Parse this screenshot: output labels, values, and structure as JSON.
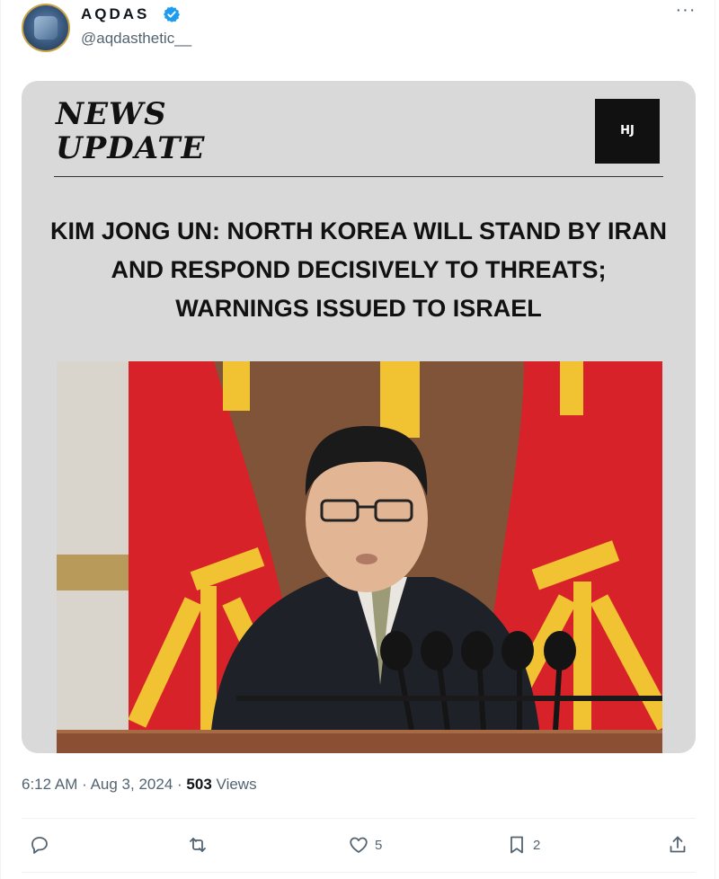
{
  "author": {
    "display_name": "AQDAS",
    "handle": "@aqdasthetic__",
    "verified": true
  },
  "more_label": "···",
  "card": {
    "logo_line1": "NEWS",
    "logo_line2": "UPDATE",
    "badge": "HJ",
    "headline": "KIM JONG UN: NORTH KOREA WILL STAND BY IRAN AND RESPOND DECISIVELY TO THREATS; WARNINGS ISSUED TO ISRAEL"
  },
  "meta": {
    "time": "6:12 AM",
    "date": "Aug 3, 2024",
    "separator": "·",
    "views_count": "503",
    "views_label": "Views"
  },
  "actions": {
    "reply_count": "",
    "retweet_count": "",
    "like_count": "5",
    "bookmark_count": "2"
  },
  "colors": {
    "accent": "#1d9bf0",
    "text_primary": "#0f1419",
    "text_secondary": "#536471",
    "card_bg": "#d9d9d9",
    "flag_red": "#d8222a",
    "emblem_gold": "#f1c232"
  }
}
